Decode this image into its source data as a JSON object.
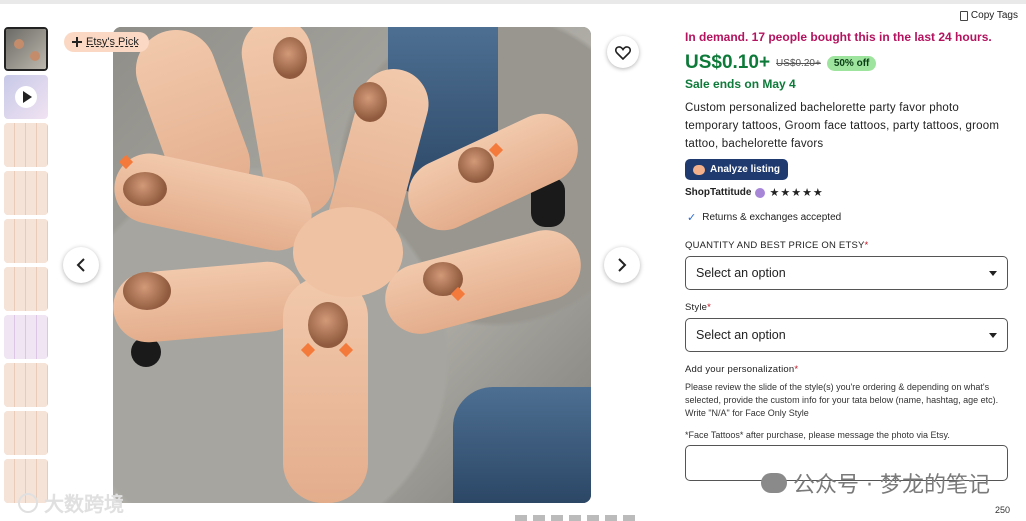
{
  "header": {
    "copy_tags_label": "Copy Tags"
  },
  "badge": {
    "label": "Etsy's Pick"
  },
  "listing": {
    "demand_text": "In demand. 17 people bought this in the last 24 hours.",
    "price": "US$0.10+",
    "original_price": "US$0.20+",
    "discount": "50% off",
    "sale_text": "Sale ends on May 4",
    "description": "Custom personalized bachelorette party favor photo temporary tattoos, Groom face tattoos, party tattoos, groom tattoo, bachelorette favors",
    "analyze_button": "Analyze listing",
    "shop_name": "ShopTattitude",
    "stars": "★★★★★",
    "returns_text": "Returns & exchanges accepted"
  },
  "form": {
    "quantity_label": "QUANTITY AND BEST PRICE ON ETSY",
    "quantity_select": "Select an option",
    "style_label": "Style",
    "style_select": "Select an option",
    "personalization_label": "Add your personalization",
    "personalization_help": "Please review the slide of the style(s) you're ordering & depending on what's selected, provide the custom info for your tata below (name, hashtag, age etc). Write \"N/A\" for Face Only Style",
    "personalization_note": "*Face Tattoos* after purchase, please message the photo via Etsy.",
    "char_counter": "250",
    "required_mark": "*"
  },
  "watermark": {
    "right_text": "公众号 · 梦龙的笔记",
    "left_text": "大数跨境"
  },
  "icons": {
    "favorite": "heart-icon",
    "prev": "chevron-left-icon",
    "next": "chevron-right-icon"
  },
  "colors": {
    "demand": "#b3135f",
    "price": "#0e7a39",
    "analyze_bg": "#1e3a6e",
    "pick_bg": "#fbd8c3"
  }
}
